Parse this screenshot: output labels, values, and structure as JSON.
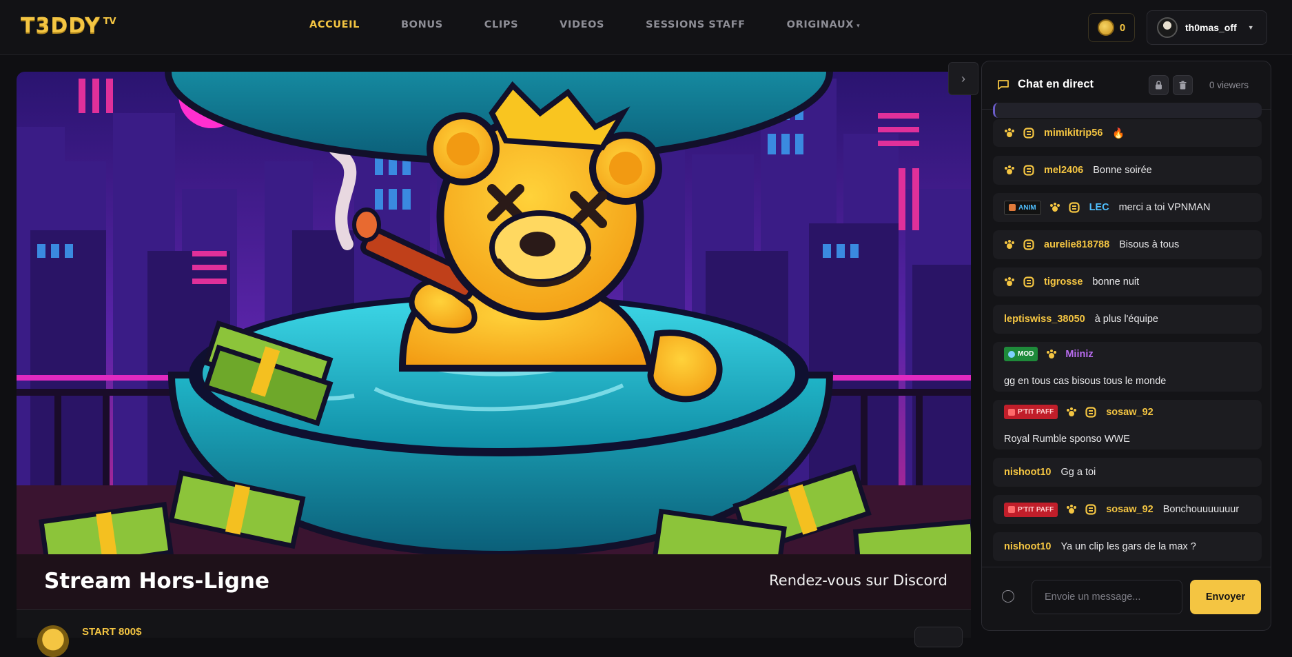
{
  "app": {
    "logo_text": "T3DDY",
    "logo_suffix": "TV"
  },
  "nav": {
    "items": [
      {
        "label": "ACCUEIL",
        "active": true
      },
      {
        "label": "BONUS",
        "active": false
      },
      {
        "label": "CLIPS",
        "active": false
      },
      {
        "label": "VIDEOS",
        "active": false
      },
      {
        "label": "SESSIONS STAFF",
        "active": false
      },
      {
        "label": "ORIGINAUX",
        "active": false,
        "has_dropdown": true
      }
    ]
  },
  "account": {
    "coins": "0",
    "username": "th0mas_off"
  },
  "player": {
    "status_title": "Stream Hors-Ligne",
    "status_link": "Rendez-vous sur Discord",
    "below_title": "START 800$"
  },
  "chat": {
    "title": "Chat en direct",
    "viewers": "0 viewers",
    "input_placeholder": "Envoie un message...",
    "send_label": "Envoyer",
    "messages": [
      {
        "username": "mimikitrip56",
        "text": "🔥",
        "name_color": "#f4c542",
        "badges": [
          "paw",
          "s"
        ]
      },
      {
        "username": "mel2406",
        "text": "Bonne soirée",
        "name_color": "#f4c542",
        "badges": [
          "paw",
          "s"
        ]
      },
      {
        "role": "ANIM",
        "username": "LEC",
        "text": "merci a toi VPNMAN",
        "name_color": "#50c0ff",
        "badges": [
          "paw",
          "s"
        ]
      },
      {
        "username": "aurelie818788",
        "text": "Bisous à tous",
        "name_color": "#f4c542",
        "badges": [
          "paw",
          "s"
        ]
      },
      {
        "username": "tigrosse",
        "text": "bonne nuit",
        "name_color": "#f4c542",
        "badges": [
          "paw",
          "s"
        ]
      },
      {
        "username": "leptiswiss_38050",
        "text": "à plus l'équipe",
        "name_color": "#f4c542",
        "badges": []
      },
      {
        "role": "MOD",
        "username": "Miiniz",
        "text": "gg en tous cas bisous tous le monde",
        "name_color": "#b96cf0",
        "badges": [
          "paw"
        ]
      },
      {
        "role": "P'TIT PAFF",
        "username": "sosaw_92",
        "text": "Royal Rumble sponso WWE",
        "name_color": "#f4c542",
        "badges": [
          "paw",
          "s"
        ]
      },
      {
        "username": "nishoot10",
        "text": "Gg a toi",
        "name_color": "#f4c542",
        "badges": []
      },
      {
        "role": "P'TIT PAFF",
        "username": "sosaw_92",
        "text": "Bonchouuuuuuur",
        "name_color": "#f4c542",
        "badges": [
          "paw",
          "s"
        ]
      },
      {
        "username": "nishoot10",
        "text": "Ya un clip les gars de la max ?",
        "name_color": "#f4c542",
        "badges": []
      }
    ]
  },
  "colors": {
    "accent": "#f4c542",
    "background": "#0f0f12",
    "panel": "#141417",
    "mod": "#1e8a3a",
    "ptit_paff": "#c11e2a",
    "anim": "#50c0ff"
  }
}
